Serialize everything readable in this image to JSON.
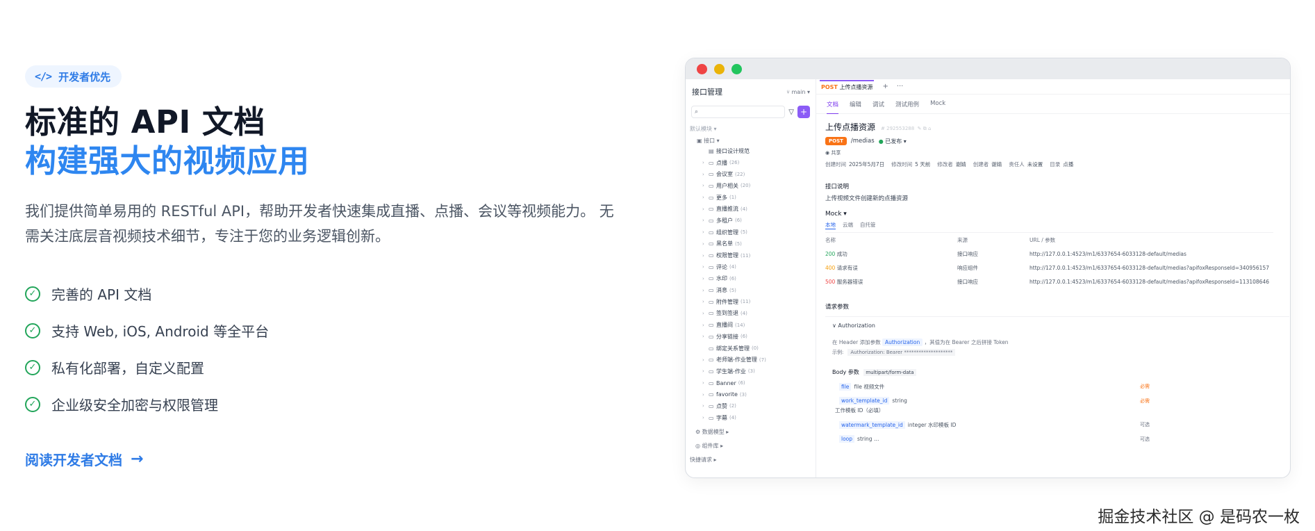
{
  "hero": {
    "badge": "开发者优先",
    "title_line1": "标准的 API 文档",
    "title_line2": "构建强大的视频应用",
    "description": "我们提供简单易用的 RESTful API，帮助开发者快速集成直播、点播、会议等视频能力。 无需关注底层音视频技术细节，专注于您的业务逻辑创新。",
    "features": [
      "完善的 API 文档",
      "支持 Web, iOS, Android 等全平台",
      "私有化部署，自定义配置",
      "企业级安全加密与权限管理"
    ],
    "link": "阅读开发者文档",
    "colors": {
      "accent": "#2e86f0",
      "check": "#22a55a"
    }
  },
  "app": {
    "sidebar": {
      "title": "接口管理",
      "branch": "main",
      "module": "默认模块",
      "root": "接口",
      "items": [
        {
          "label": "接口设计规范",
          "count": "",
          "type": "doc"
        },
        {
          "label": "点播",
          "count": "(26)",
          "type": "folder"
        },
        {
          "label": "会议室",
          "count": "(22)",
          "type": "folder"
        },
        {
          "label": "用户相关",
          "count": "(20)",
          "type": "folder"
        },
        {
          "label": "更多",
          "count": "(1)",
          "type": "folder"
        },
        {
          "label": "直播推流",
          "count": "(4)",
          "type": "folder"
        },
        {
          "label": "多租户",
          "count": "(6)",
          "type": "folder"
        },
        {
          "label": "组织管理",
          "count": "(5)",
          "type": "folder"
        },
        {
          "label": "黑名单",
          "count": "(5)",
          "type": "folder"
        },
        {
          "label": "权限管理",
          "count": "(11)",
          "type": "folder"
        },
        {
          "label": "评论",
          "count": "(4)",
          "type": "folder"
        },
        {
          "label": "水印",
          "count": "(6)",
          "type": "folder"
        },
        {
          "label": "消息",
          "count": "(5)",
          "type": "folder"
        },
        {
          "label": "附件管理",
          "count": "(11)",
          "type": "folder"
        },
        {
          "label": "签到签退",
          "count": "(4)",
          "type": "folder"
        },
        {
          "label": "直播间",
          "count": "(14)",
          "type": "folder"
        },
        {
          "label": "分享链接",
          "count": "(6)",
          "type": "folder"
        },
        {
          "label": "绑定关系管理",
          "count": "(0)",
          "type": "leaf"
        },
        {
          "label": "老师端-作业管理",
          "count": "(7)",
          "type": "folder"
        },
        {
          "label": "学生端-作业",
          "count": "(3)",
          "type": "folder"
        },
        {
          "label": "Banner",
          "count": "(6)",
          "type": "folder"
        },
        {
          "label": "favorite",
          "count": "(3)",
          "type": "folder"
        },
        {
          "label": "点赞",
          "count": "(2)",
          "type": "folder"
        },
        {
          "label": "字幕",
          "count": "(4)",
          "type": "folder"
        }
      ],
      "footer": [
        "数据模型",
        "组件库",
        "快捷请求"
      ]
    },
    "tab": {
      "method": "POST",
      "name": "上传点播资源"
    },
    "subtabs": [
      "文档",
      "编辑",
      "调试",
      "测试用例",
      "Mock"
    ],
    "doc": {
      "title": "上传点播资源",
      "id": "292553288",
      "method": "POST",
      "path": "/medias",
      "status": "已发布",
      "share": "共享",
      "meta": [
        {
          "k": "创建时间",
          "v": "2025年5月7日"
        },
        {
          "k": "修改时间",
          "v": "5 天前"
        },
        {
          "k": "修改者",
          "v": "谢婧"
        },
        {
          "k": "创建者",
          "v": "谢婧"
        },
        {
          "k": "责任人",
          "v": "未设置"
        },
        {
          "k": "目录",
          "v": "点播"
        }
      ],
      "desc_title": "接口说明",
      "desc": "上传视频文件创建新的点播资源",
      "mock_title": "Mock",
      "mock_tabs": [
        "本地",
        "云端",
        "自托管"
      ],
      "mock_headers": [
        "名称",
        "来源",
        "URL / 参数"
      ],
      "mock_rows": [
        {
          "code": "200",
          "name": "成功",
          "src": "接口响应",
          "url": "http://127.0.0.1:4523/m1/6337654-6033128-default/medias"
        },
        {
          "code": "400",
          "name": "请求有误",
          "src": "响应组件",
          "url": "http://127.0.0.1:4523/m1/6337654-6033128-default/medias?apifoxResponseId=340956157"
        },
        {
          "code": "500",
          "name": "服务器错误",
          "src": "接口响应",
          "url": "http://127.0.0.1:4523/m1/6337654-6033128-default/medias?apifoxResponseId=113108646"
        }
      ],
      "req_title": "请求参数",
      "auth_title": "Authorization",
      "auth_text_pre": "在 Header 添加参数",
      "auth_param": "Authorization",
      "auth_text_post": "，其值为在 Bearer 之后拼接 Token",
      "auth_example_label": "示例:",
      "auth_example": "Authorization: Bearer ********************",
      "body_title": "Body 参数",
      "body_type": "multipart/form-data",
      "params": [
        {
          "name": "file",
          "type": "file",
          "desc": "视频文件",
          "req": "必需"
        },
        {
          "name": "work_template_id",
          "type": "string",
          "desc": "工作模板 ID（必填）",
          "req": "必需"
        },
        {
          "name": "watermark_template_id",
          "type": "integer",
          "desc": "水印模板 ID",
          "req": "可选"
        },
        {
          "name": "loop",
          "type": "string",
          "desc": "…",
          "req": "可选"
        }
      ]
    }
  },
  "watermark": "掘金技术社区 @ 是码农一枚"
}
